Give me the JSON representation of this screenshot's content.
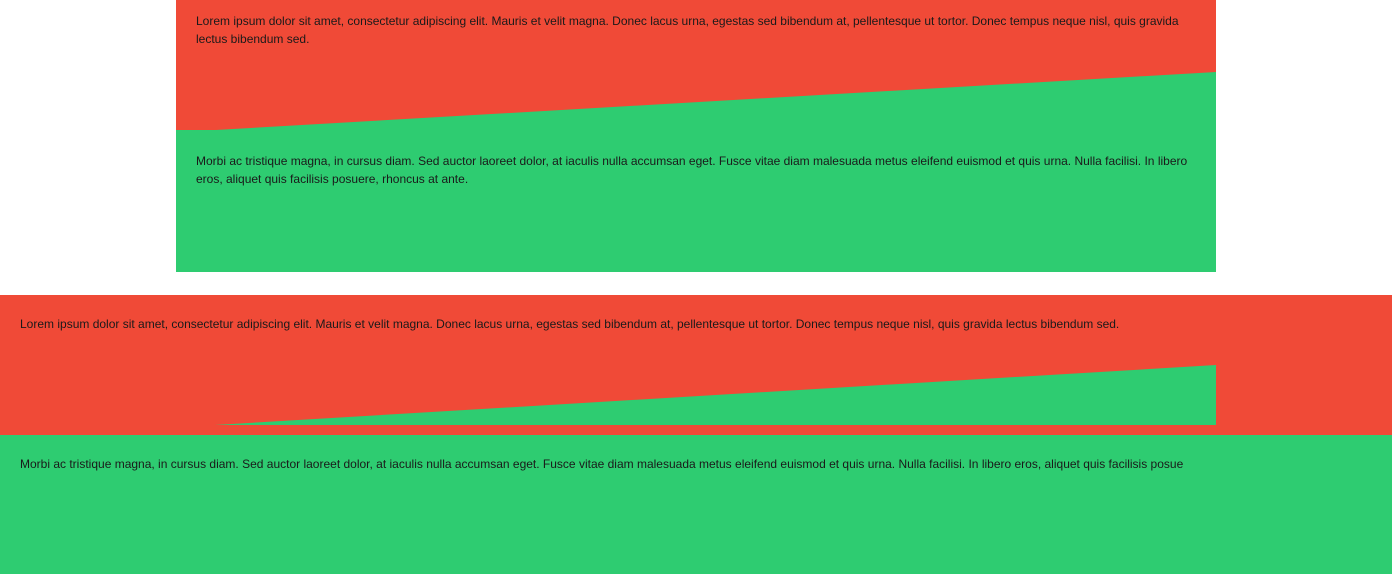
{
  "demos": [
    {
      "red_text": "Lorem ipsum dolor sit amet, consectetur adipiscing elit. Mauris et velit magna. Donec lacus urna, egestas sed bibendum at, pellentesque ut tortor. Donec tempus neque nisl, quis gravida lectus bibendum sed.",
      "green_text": "Morbi ac tristique magna, in cursus diam. Sed auctor laoreet dolor, at iaculis nulla accumsan eget. Fusce vitae diam malesuada metus eleifend euismod et quis urna. Nulla facilisi. In libero eros, aliquet quis facilisis posuere, rhoncus at ante."
    },
    {
      "red_text": "Lorem ipsum dolor sit amet, consectetur adipiscing elit. Mauris et velit magna. Donec lacus urna, egestas sed bibendum at, pellentesque ut tortor. Donec tempus neque nisl, quis gravida lectus bibendum sed.",
      "green_text": "Morbi ac tristique magna, in cursus diam. Sed auctor laoreet dolor, at iaculis nulla accumsan eget. Fusce vitae diam malesuada metus eleifend euismod et quis urna. Nulla facilisi. In libero eros, aliquet quis facilisis posue"
    }
  ],
  "colors": {
    "red": "#f04a37",
    "green": "#2ecc71",
    "background": "#ffffff",
    "text": "#1a1a1a"
  }
}
